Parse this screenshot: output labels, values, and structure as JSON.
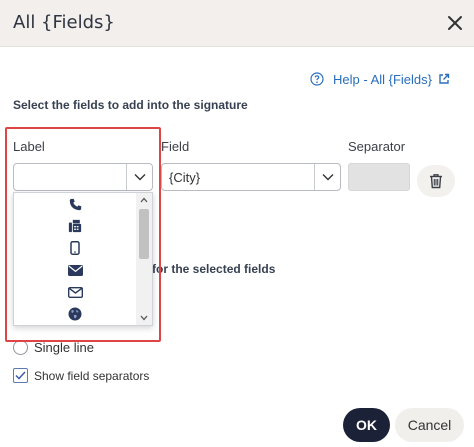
{
  "dialog": {
    "title": "All {Fields}",
    "close_icon": "close-icon"
  },
  "help": {
    "text": "Help - All {Fields}",
    "icon": "question-circle-icon",
    "external_icon": "external-link-icon"
  },
  "instructions": "Select the fields to add into the signature",
  "columns": {
    "label": "Label",
    "field": "Field",
    "separator": "Separator"
  },
  "row": {
    "label_value": "",
    "field_value": "{City}",
    "separator_value": "",
    "delete_icon": "trash-icon"
  },
  "label_dropdown": {
    "options": [
      {
        "icon": "phone-icon"
      },
      {
        "icon": "fax-icon"
      },
      {
        "icon": "mobile-icon"
      },
      {
        "icon": "envelope-filled-icon"
      },
      {
        "icon": "envelope-outline-icon"
      },
      {
        "icon": "globe-icon"
      }
    ]
  },
  "layout_section": {
    "heading_fragment": "for the selected fields"
  },
  "options": {
    "single_line": "Single line",
    "show_separators": "Show field separators",
    "show_separators_checked": true
  },
  "footer": {
    "ok": "OK",
    "cancel": "Cancel"
  },
  "colors": {
    "accent": "#2a6ebb",
    "primary_button": "#1b2238",
    "highlight": "#e04545",
    "header_bg": "#f2efec"
  }
}
